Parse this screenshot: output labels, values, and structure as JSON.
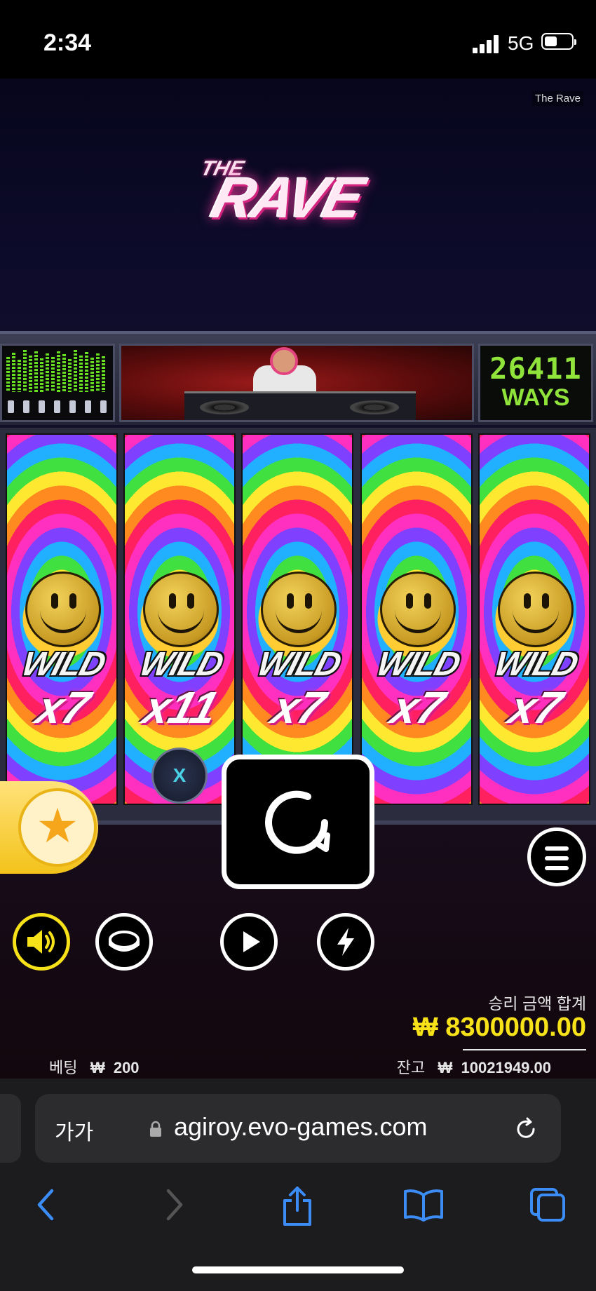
{
  "status_bar": {
    "time": "2:34",
    "network": "5G",
    "battery_icon": "battery-icon",
    "signal_icon": "signal-icon"
  },
  "game": {
    "name_label": "The Rave",
    "logo_small": "THE",
    "logo_big": "RAVE",
    "ways_count": "26411",
    "ways_label": "WAYS",
    "reels": [
      {
        "symbol": "WILD",
        "multiplier": "x7"
      },
      {
        "symbol": "WILD",
        "multiplier": "x11"
      },
      {
        "symbol": "WILD",
        "multiplier": "x7"
      },
      {
        "symbol": "WILD",
        "multiplier": "x7"
      },
      {
        "symbol": "WILD",
        "multiplier": "x7"
      }
    ],
    "xbadge": "X",
    "feature_icon": "star-bolt-icon",
    "win_label": "승리 금액 합계",
    "win_amount": "₩ 8300000.00",
    "bet_label": "베팅",
    "bet_currency": "₩",
    "bet_value": "200",
    "balance_label": "잔고",
    "balance_currency": "₩",
    "balance_value": "10021949.00",
    "colors": {
      "win_accent": "#f7e21a",
      "ways_green": "#8fe33a",
      "logo_pink": "#ff3ea5"
    }
  },
  "browser": {
    "text_size_label": "가가",
    "url": "agiroy.evo-games.com"
  }
}
